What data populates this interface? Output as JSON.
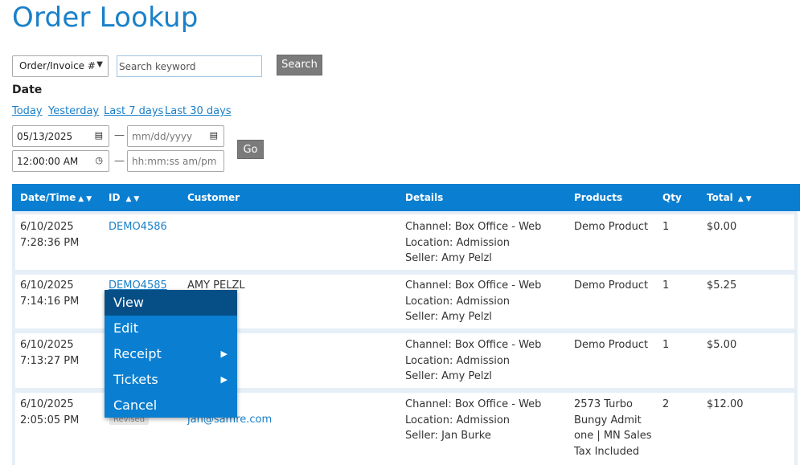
{
  "page": {
    "title": "Order Lookup"
  },
  "search": {
    "type_selected": "Order/Invoice #",
    "keyword_placeholder": "Search keyword",
    "button_label": "Search"
  },
  "date_filter": {
    "label": "Date",
    "quick_links": [
      "Today",
      "Yesterday",
      "Last 7 days",
      "Last 30 days"
    ],
    "start_date": "05/13/2025",
    "end_date_placeholder": "mm/dd/yyyy",
    "start_time": "12:00:00 AM",
    "end_time_placeholder": "hh:mm:ss am/pm",
    "separator": "—",
    "go_label": "Go"
  },
  "table": {
    "columns": [
      "Date/Time",
      "ID",
      "Customer",
      "Details",
      "Products",
      "Qty",
      "Total"
    ],
    "rows": [
      {
        "date": "6/10/2025",
        "time": "7:28:36 PM",
        "id": "DEMO4586",
        "customer": "",
        "details": [
          "Channel: Box Office - Web",
          "Location: Admission",
          "Seller: Amy Pelzl"
        ],
        "products": [
          "Demo Product"
        ],
        "qty": "1",
        "total": "$0.00"
      },
      {
        "date": "6/10/2025",
        "time": "7:14:16 PM",
        "id": "DEMO4585",
        "customer": "AMY PELZL",
        "details": [
          "Channel: Box Office - Web",
          "Location: Admission",
          "Seller: Amy Pelzl"
        ],
        "products": [
          "Demo Product"
        ],
        "qty": "1",
        "total": "$5.25"
      },
      {
        "date": "6/10/2025",
        "time": "7:13:27 PM",
        "id": "",
        "customer": "",
        "details": [
          "Channel: Box Office - Web",
          "Location: Admission",
          "Seller: Amy Pelzl"
        ],
        "products": [
          "Demo Product"
        ],
        "qty": "1",
        "total": "$5.00"
      },
      {
        "date": "6/10/2025",
        "time": "2:05:05 PM",
        "id": "",
        "badge": "Revised",
        "customer": "jan@samre.com",
        "details": [
          "Channel: Box Office - Web",
          "Location: Admission",
          "Seller: Jan Burke"
        ],
        "products": [
          "2573 Turbo",
          "Bungy Admit",
          "one | MN Sales",
          "Tax Included"
        ],
        "qty": "2",
        "total": "$12.00"
      }
    ]
  },
  "context_menu": {
    "items": [
      "View",
      "Edit",
      "Receipt",
      "Tickets",
      "Cancel"
    ],
    "submenu_glyph": "▶"
  }
}
